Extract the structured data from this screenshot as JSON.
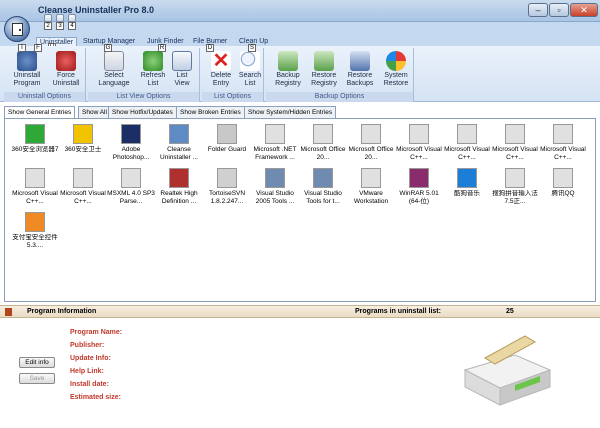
{
  "window": {
    "title": "Cleanse Uninstaller Pro 8.0",
    "minimize": "–",
    "maximize": "▫",
    "close": "✕"
  },
  "qat_keytips": [
    "2",
    "3",
    "4"
  ],
  "ribbon": {
    "tabs": [
      {
        "label": "Uninstaller",
        "keytip": "U"
      },
      {
        "label": "Startup Manager",
        "keytip": ""
      },
      {
        "label": "Junk Finder",
        "keytip": ""
      },
      {
        "label": "File Burner",
        "keytip": ""
      },
      {
        "label": "Clean Up",
        "keytip": ""
      }
    ],
    "groups": {
      "uninstall": {
        "label": "Uninstall Options",
        "buttons": [
          {
            "label": "Uninstall\nProgram",
            "keytip": "I"
          },
          {
            "label": "Force\nUninstall",
            "keytip": "F"
          }
        ]
      },
      "listview": {
        "label": "List View Options",
        "buttons": [
          {
            "label": "Select\nLanguage",
            "keytip": "G"
          },
          {
            "label": "Refresh\nList",
            "keytip": "R"
          },
          {
            "label": "List\nView",
            "keytip": "V"
          }
        ]
      },
      "list": {
        "label": "List Options",
        "buttons": [
          {
            "label": "Delete\nEntry",
            "keytip": "D"
          },
          {
            "label": "Search\nList",
            "keytip": "S"
          }
        ]
      },
      "backup": {
        "label": "Backup Options",
        "buttons": [
          {
            "label": "Backup\nRegistry"
          },
          {
            "label": "Restore\nRegistry"
          },
          {
            "label": "Restore\nBackups"
          },
          {
            "label": "System\nRestore"
          }
        ]
      }
    }
  },
  "view_tabs": [
    "Show General Entries",
    "Show All",
    "Show Hotfix/Updates",
    "Show Broken Entries",
    "Show System/Hidden Entries"
  ],
  "programs": [
    {
      "name": "360安全浏览器7",
      "color": "#2ea836"
    },
    {
      "name": "360安全卫士",
      "color": "#f2c300"
    },
    {
      "name": "Adobe Photoshop...",
      "color": "#1b2f66"
    },
    {
      "name": "Cleanse Uninstaller ...",
      "color": "#5e8bc4"
    },
    {
      "name": "Folder Guard",
      "color": "#c8c8c8"
    },
    {
      "name": "Microsoft .NET Framework ...",
      "color": "#e0e0e0"
    },
    {
      "name": "Microsoft Office 20...",
      "color": "#e0e0e0"
    },
    {
      "name": "Microsoft Office 20...",
      "color": "#e0e0e0"
    },
    {
      "name": "Microsoft Visual C++...",
      "color": "#e0e0e0"
    },
    {
      "name": "Microsoft Visual C++...",
      "color": "#e0e0e0"
    },
    {
      "name": "Microsoft Visual C++...",
      "color": "#e0e0e0"
    },
    {
      "name": "Microsoft Visual C++...",
      "color": "#e0e0e0"
    },
    {
      "name": "Microsoft Visual C++...",
      "color": "#e0e0e0"
    },
    {
      "name": "Microsoft Visual C++...",
      "color": "#e0e0e0"
    },
    {
      "name": "MSXML 4.0 SP3 Parse...",
      "color": "#e0e0e0"
    },
    {
      "name": "Realtek High Definition ...",
      "color": "#b03030"
    },
    {
      "name": "TortoiseSVN 1.8.2.247...",
      "color": "#d0d0d0"
    },
    {
      "name": "Visual Studio 2005 Tools ...",
      "color": "#708bb0"
    },
    {
      "name": "Visual Studio Tools for t...",
      "color": "#708bb0"
    },
    {
      "name": "VMware Workstation",
      "color": "#e0e0e0"
    },
    {
      "name": "WinRAR 5.01 (64-位)",
      "color": "#8a2b6b"
    },
    {
      "name": "酷狗音乐",
      "color": "#1c7ed6"
    },
    {
      "name": "搜狗拼音输入法 7.5正...",
      "color": "#e0e0e0"
    },
    {
      "name": "腾讯QQ",
      "color": "#e0e0e0"
    },
    {
      "name": "支付宝安全控件 5.3....",
      "color": "#f08a24"
    }
  ],
  "info": {
    "title": "Program Information",
    "count_label": "Programs in uninstall list:",
    "count": "25",
    "fields": [
      "Program Name:",
      "Publisher:",
      "Update Info:",
      "Help Link:",
      "Install date:",
      "Estimated size:"
    ],
    "edit_label": "Edit info",
    "save_label": "Save"
  }
}
